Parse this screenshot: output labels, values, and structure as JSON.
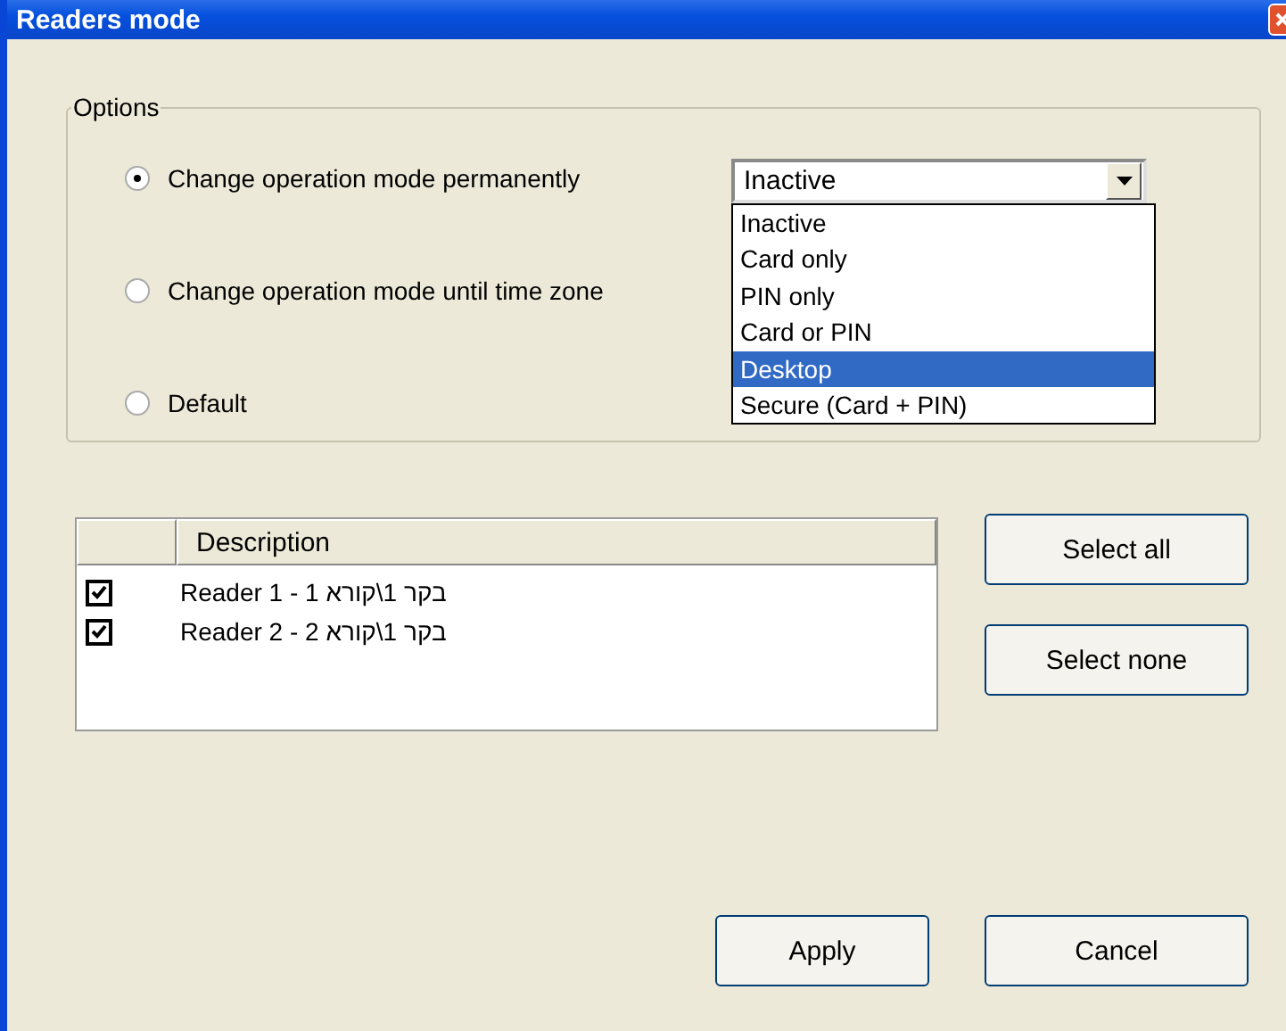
{
  "window": {
    "title": "Readers mode"
  },
  "options": {
    "label": "Options",
    "radios": [
      {
        "label": "Change operation mode  permanently",
        "selected": true
      },
      {
        "label": "Change operation mode until time zone",
        "selected": false
      },
      {
        "label": "Default",
        "selected": false
      }
    ],
    "mode_dropdown": {
      "value": "Inactive",
      "expanded": true,
      "items": [
        {
          "label": "Inactive",
          "highlighted": false
        },
        {
          "label": "Card only",
          "highlighted": false
        },
        {
          "label": "PIN only",
          "highlighted": false
        },
        {
          "label": "Card or PIN",
          "highlighted": false
        },
        {
          "label": "Desktop",
          "highlighted": true
        },
        {
          "label": "Secure (Card + PIN)",
          "highlighted": false
        }
      ]
    }
  },
  "readers": {
    "columns": [
      "Description"
    ],
    "rows": [
      {
        "description": "Reader 1 - בקר 1\\קורא 1",
        "checked": true
      },
      {
        "description": "Reader 2 - בקר 1\\קורא 2",
        "checked": true
      }
    ]
  },
  "side_buttons": [
    "Select all",
    "Select none"
  ],
  "buttons": [
    "Apply",
    "Cancel"
  ]
}
